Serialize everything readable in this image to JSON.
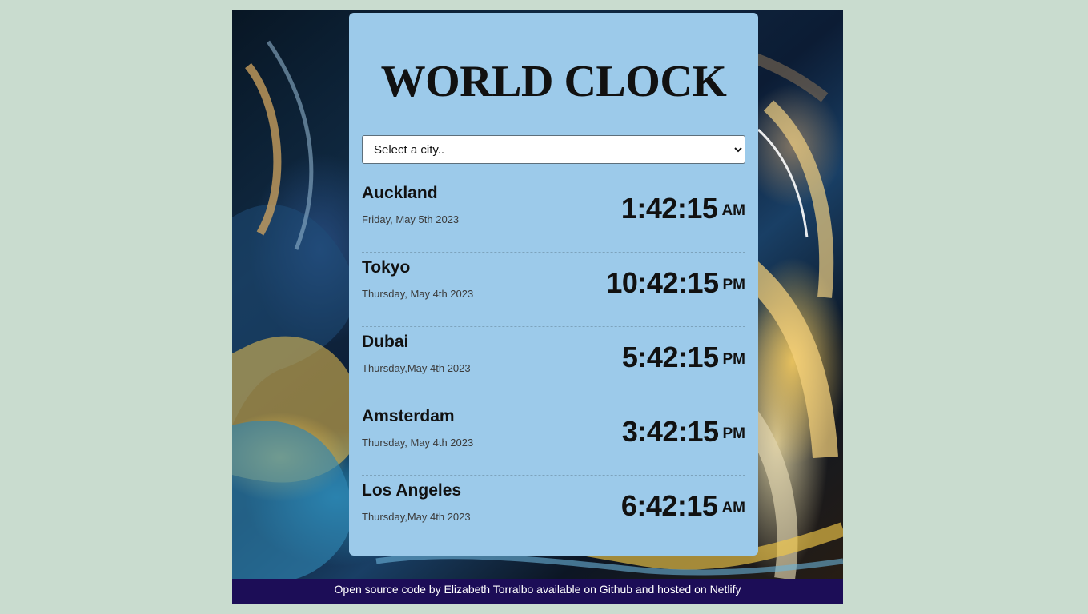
{
  "app": {
    "title": "WORLD CLOCK"
  },
  "selector": {
    "value": "Select a city.."
  },
  "cities": [
    {
      "name": "Auckland",
      "date": "Friday, May 5th 2023",
      "time": "1:42:15",
      "meridiem": "AM"
    },
    {
      "name": "Tokyo",
      "date": "Thursday, May 4th 2023",
      "time": "10:42:15",
      "meridiem": "PM"
    },
    {
      "name": "Dubai",
      "date": "Thursday,May 4th 2023",
      "time": "5:42:15",
      "meridiem": "PM"
    },
    {
      "name": "Amsterdam",
      "date": "Thursday, May 4th 2023",
      "time": "3:42:15",
      "meridiem": "PM"
    },
    {
      "name": "Los Angeles",
      "date": "Thursday,May 4th 2023",
      "time": "6:42:15",
      "meridiem": "AM"
    }
  ],
  "footer": {
    "text": "Open source code by Elizabeth Torralbo available on Github and hosted on Netlify"
  },
  "colors": {
    "page_background": "#c9dccf",
    "panel_background": "#9ccaea",
    "footer_background": "#1c0d57",
    "text": "#111111"
  }
}
